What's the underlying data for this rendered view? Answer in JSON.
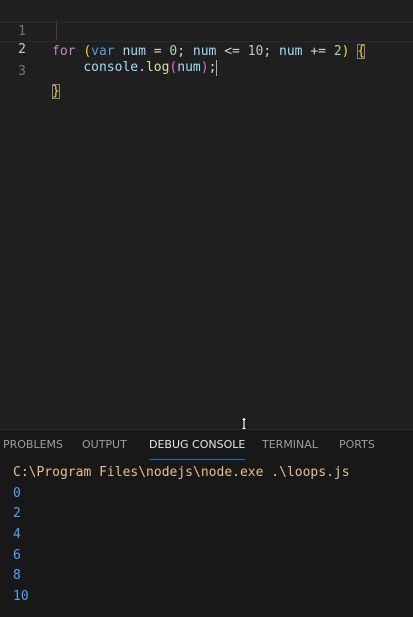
{
  "editor": {
    "lines": [
      {
        "number": "1"
      },
      {
        "number": "2"
      },
      {
        "number": "3"
      }
    ],
    "code": {
      "for_kw": "for",
      "paren_open": "(",
      "var_kw": "var",
      "num": "num",
      "assign": " = ",
      "zero": "0",
      "semi1": "; ",
      "num2": "num",
      "le": " <= ",
      "ten": "10",
      "semi2": "; ",
      "num3": "num",
      "plus_eq": " += ",
      "two": "2",
      "paren_close": ")",
      "brace_open": "{",
      "console_obj": "console",
      "dot": ".",
      "log_fn": "log",
      "call_open": "(",
      "arg": "num",
      "call_close": ")",
      "semicolon": ";",
      "brace_close": "}"
    }
  },
  "panel": {
    "tabs": [
      {
        "label": "PROBLEMS"
      },
      {
        "label": "OUTPUT"
      },
      {
        "label": "DEBUG CONSOLE"
      },
      {
        "label": "TERMINAL"
      },
      {
        "label": "PORTS"
      }
    ],
    "active_tab": "DEBUG CONSOLE",
    "console": {
      "command": "C:\\Program Files\\nodejs\\node.exe .\\loops.js",
      "outputs": [
        "0",
        "2",
        "4",
        "6",
        "8",
        "10"
      ]
    }
  },
  "colors": {
    "keyword": "#c586c0",
    "storage": "#569cd6",
    "variable": "#9cdcfe",
    "number": "#b5cea8",
    "bracket_level1": "#ffd700",
    "bracket_level2": "#da70d6",
    "function": "#dcdcaa",
    "command_text": "#e2c08d",
    "output_text": "#4fa3ff",
    "active_tab_underline": "#0078d4"
  },
  "icons": {
    "resize": "vertical-resize-icon"
  }
}
